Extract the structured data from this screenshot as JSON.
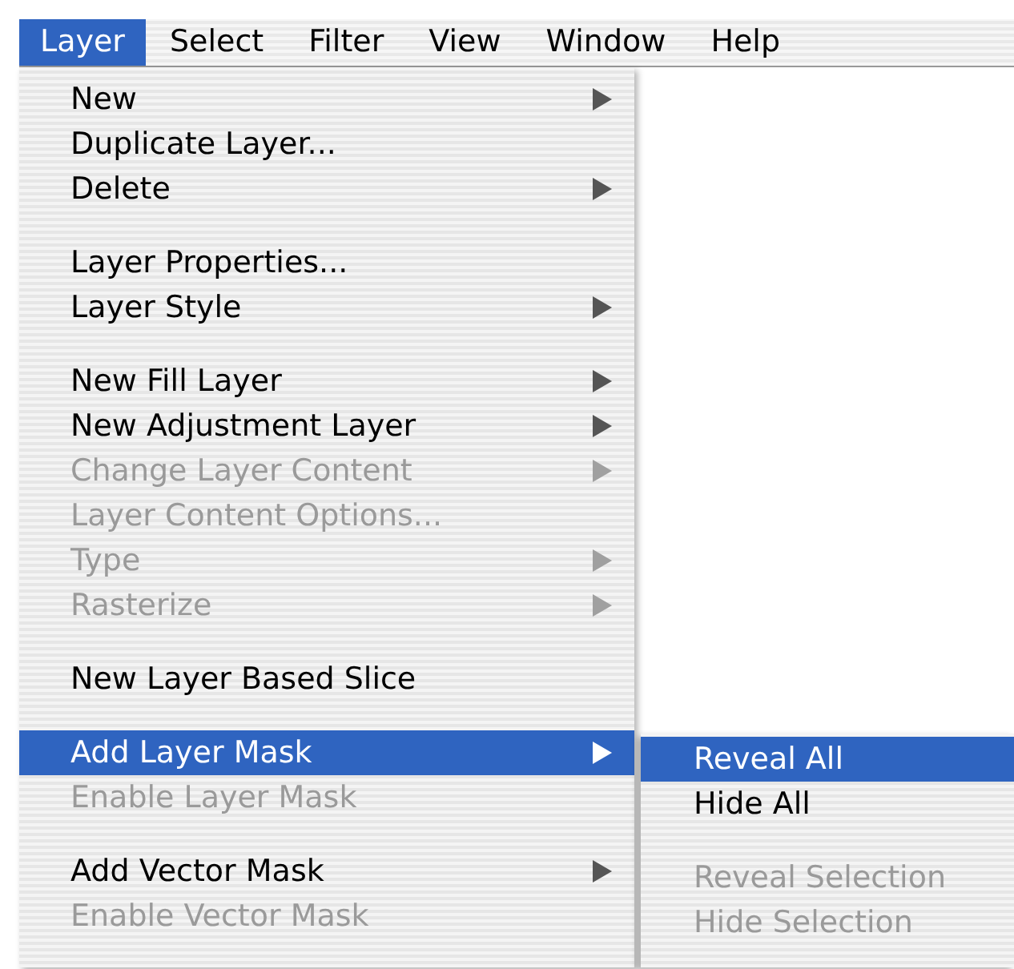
{
  "menu_bar": [
    {
      "label": "Layer",
      "selected": true
    },
    {
      "label": "Select",
      "selected": false
    },
    {
      "label": "Filter",
      "selected": false
    },
    {
      "label": "View",
      "selected": false
    },
    {
      "label": "Window",
      "selected": false
    },
    {
      "label": "Help",
      "selected": false
    }
  ],
  "menu": [
    {
      "kind": "item",
      "label": "New",
      "disabled": false,
      "submenu": true,
      "selected": false
    },
    {
      "kind": "item",
      "label": "Duplicate Layer...",
      "disabled": false,
      "submenu": false,
      "selected": false
    },
    {
      "kind": "item",
      "label": "Delete",
      "disabled": false,
      "submenu": true,
      "selected": false
    },
    {
      "kind": "separator"
    },
    {
      "kind": "item",
      "label": "Layer Properties...",
      "disabled": false,
      "submenu": false,
      "selected": false
    },
    {
      "kind": "item",
      "label": "Layer Style",
      "disabled": false,
      "submenu": true,
      "selected": false
    },
    {
      "kind": "separator"
    },
    {
      "kind": "item",
      "label": "New Fill Layer",
      "disabled": false,
      "submenu": true,
      "selected": false
    },
    {
      "kind": "item",
      "label": "New Adjustment Layer",
      "disabled": false,
      "submenu": true,
      "selected": false
    },
    {
      "kind": "item",
      "label": "Change Layer Content",
      "disabled": true,
      "submenu": true,
      "selected": false
    },
    {
      "kind": "item",
      "label": "Layer Content Options...",
      "disabled": true,
      "submenu": false,
      "selected": false
    },
    {
      "kind": "item",
      "label": "Type",
      "disabled": true,
      "submenu": true,
      "selected": false
    },
    {
      "kind": "item",
      "label": "Rasterize",
      "disabled": true,
      "submenu": true,
      "selected": false
    },
    {
      "kind": "separator"
    },
    {
      "kind": "item",
      "label": "New Layer Based Slice",
      "disabled": false,
      "submenu": false,
      "selected": false
    },
    {
      "kind": "separator"
    },
    {
      "kind": "item",
      "label": "Add Layer Mask",
      "disabled": false,
      "submenu": true,
      "selected": true
    },
    {
      "kind": "item",
      "label": "Enable Layer Mask",
      "disabled": true,
      "submenu": false,
      "selected": false
    },
    {
      "kind": "separator"
    },
    {
      "kind": "item",
      "label": "Add Vector Mask",
      "disabled": false,
      "submenu": true,
      "selected": false
    },
    {
      "kind": "item",
      "label": "Enable Vector Mask",
      "disabled": true,
      "submenu": false,
      "selected": false
    }
  ],
  "submenu": [
    {
      "kind": "item",
      "label": "Reveal All",
      "disabled": false,
      "selected": true
    },
    {
      "kind": "item",
      "label": "Hide All",
      "disabled": false,
      "selected": false
    },
    {
      "kind": "separator"
    },
    {
      "kind": "item",
      "label": "Reveal Selection",
      "disabled": true,
      "selected": false
    },
    {
      "kind": "item",
      "label": "Hide Selection",
      "disabled": true,
      "selected": false
    }
  ]
}
